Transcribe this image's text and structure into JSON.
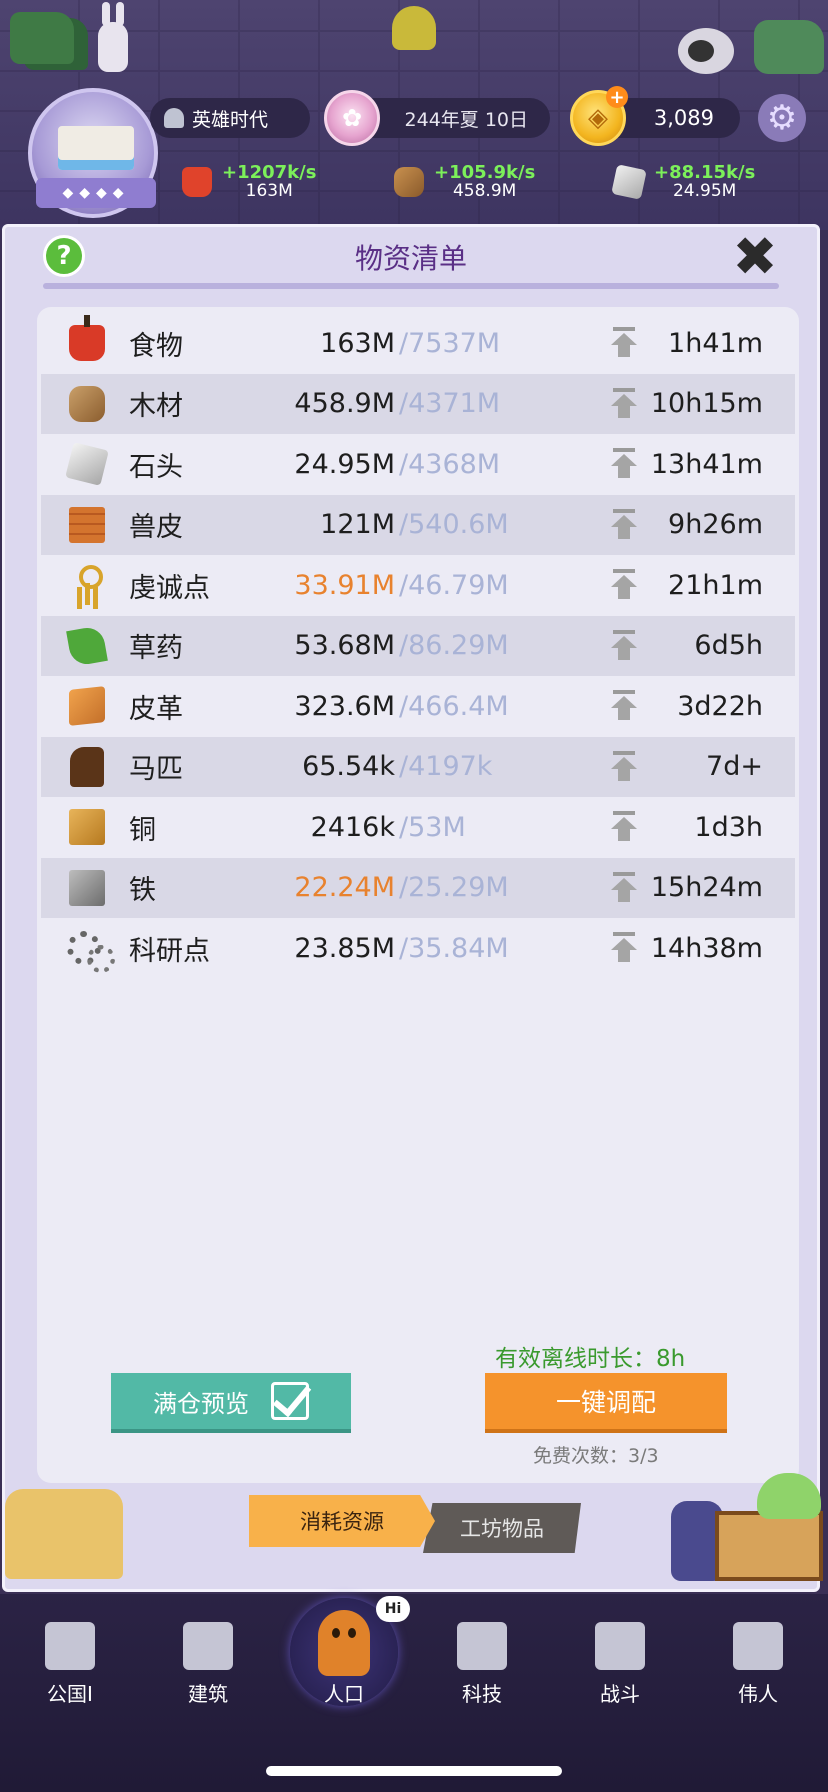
{
  "header": {
    "era": "英雄时代",
    "date": "244年夏 10日",
    "gold": "3,089",
    "production": [
      {
        "icon": "apple-icon",
        "rate": "+1207k/s",
        "total": "163M"
      },
      {
        "icon": "wood-icon",
        "rate": "+105.9k/s",
        "total": "458.9M"
      },
      {
        "icon": "stone-icon",
        "rate": "+88.15k/s",
        "total": "24.95M"
      }
    ]
  },
  "panel": {
    "title": "物资清单",
    "help": "?",
    "close": "✖"
  },
  "resources": [
    {
      "name": "食物",
      "amount": "163M",
      "cap": "/7537M",
      "time": "1h41m",
      "icon": "food-icon",
      "warn": false
    },
    {
      "name": "木材",
      "amount": "458.9M",
      "cap": "/4371M",
      "time": "10h15m",
      "icon": "wood-icon",
      "warn": false
    },
    {
      "name": "石头",
      "amount": "24.95M",
      "cap": "/4368M",
      "time": "13h41m",
      "icon": "stone-icon",
      "warn": false
    },
    {
      "name": "兽皮",
      "amount": "121M",
      "cap": "/540.6M",
      "time": "9h26m",
      "icon": "hide-icon",
      "warn": false
    },
    {
      "name": "虔诚点",
      "amount": "33.91M",
      "cap": "/46.79M",
      "time": "21h1m",
      "icon": "ankh-icon",
      "warn": true
    },
    {
      "name": "草药",
      "amount": "53.68M",
      "cap": "/86.29M",
      "time": "6d5h",
      "icon": "herb-icon",
      "warn": false
    },
    {
      "name": "皮革",
      "amount": "323.6M",
      "cap": "/466.4M",
      "time": "3d22h",
      "icon": "leather-icon",
      "warn": false
    },
    {
      "name": "马匹",
      "amount": "65.54k",
      "cap": "/4197k",
      "time": "7d+",
      "icon": "horse-icon",
      "warn": false
    },
    {
      "name": "铜",
      "amount": "2416k",
      "cap": "/53M",
      "time": "1d3h",
      "icon": "copper-icon",
      "warn": false
    },
    {
      "name": "铁",
      "amount": "22.24M",
      "cap": "/25.29M",
      "time": "15h24m",
      "icon": "iron-icon",
      "warn": true
    },
    {
      "name": "科研点",
      "amount": "23.85M",
      "cap": "/35.84M",
      "time": "14h38m",
      "icon": "gears-icon",
      "warn": false
    }
  ],
  "controls": {
    "offline": "有效离线时长：8h",
    "preview_label": "满仓预览",
    "allocate_label": "一键调配",
    "free_times": "免费次数：3/3"
  },
  "tabs": {
    "consume": "消耗资源",
    "workshop": "工坊物品"
  },
  "nav": {
    "items": [
      "公国I",
      "建筑",
      "人口",
      "科技",
      "战斗",
      "伟人"
    ],
    "hi": "Hi"
  },
  "colors": {
    "warn": "#e8822e",
    "cap": "#a9b3d6",
    "rate": "#7cf05a",
    "preview_btn": "#52b9a6",
    "allocate_btn": "#f5932c",
    "title": "#5a2f86"
  }
}
